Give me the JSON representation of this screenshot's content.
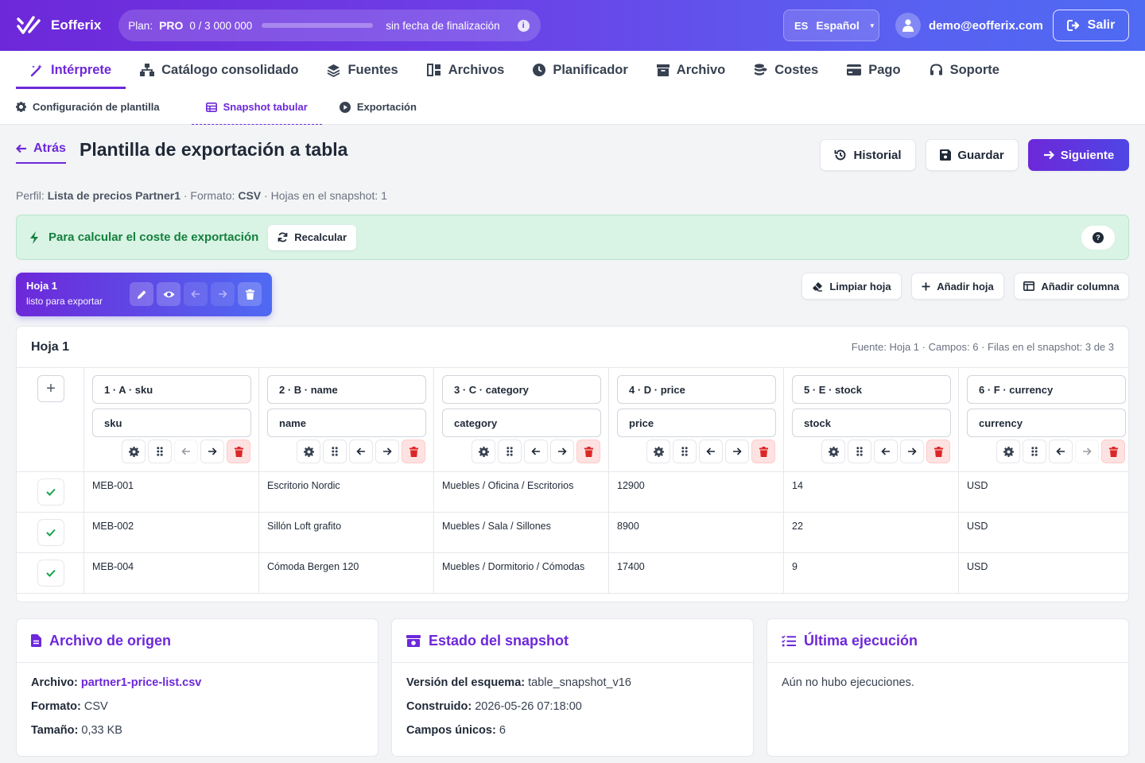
{
  "app": {
    "name": "Eofferix"
  },
  "plan": {
    "label": "Plan:",
    "tier": "PRO",
    "usage": "0 / 3 000 000",
    "usage_fraction": 0,
    "expiry": "sin fecha de finalización"
  },
  "language": {
    "code": "ES",
    "name": "Español"
  },
  "user": {
    "email": "demo@eofferix.com"
  },
  "logout": {
    "label": "Salir"
  },
  "nav": {
    "items": [
      {
        "label": "Intérprete",
        "icon": "wand-icon"
      },
      {
        "label": "Catálogo consolidado",
        "icon": "sitemap-icon"
      },
      {
        "label": "Fuentes",
        "icon": "layers-icon"
      },
      {
        "label": "Archivos",
        "icon": "tables-icon"
      },
      {
        "label": "Planificador",
        "icon": "clock-icon"
      },
      {
        "label": "Archivo",
        "icon": "archive-icon"
      },
      {
        "label": "Costes",
        "icon": "coins-icon"
      },
      {
        "label": "Pago",
        "icon": "card-icon"
      },
      {
        "label": "Soporte",
        "icon": "headset-icon"
      }
    ]
  },
  "subnav": {
    "items": [
      {
        "label": "Configuración de plantilla"
      },
      {
        "label": "Snapshot tabular"
      },
      {
        "label": "Exportación"
      }
    ]
  },
  "header": {
    "back": "Atrás",
    "title": "Plantilla de exportación a tabla",
    "history": "Historial",
    "save": "Guardar",
    "next": "Siguiente"
  },
  "profile": {
    "profile_label": "Perfil:",
    "profile": "Lista de precios Partner1",
    "format_label": "· Formato:",
    "format": "CSV",
    "sheets": "· Hojas en el snapshot: 1"
  },
  "alert": {
    "text": "Para calcular el coste de exportación",
    "recalc": "Recalcular",
    "help": "?"
  },
  "sheet": {
    "name": "Hoja 1",
    "status": "listo para exportar"
  },
  "sheet_actions": {
    "clear": "Limpiar hoja",
    "add_sheet": "Añadir hoja",
    "add_column": "Añadir columna"
  },
  "table": {
    "title": "Hoja 1",
    "meta": "Fuente: Hoja 1 · Campos: 6 · Filas en el snapshot: 3 de 3",
    "add": "+",
    "columns": [
      {
        "header": "1 · A · sku",
        "field": "sku"
      },
      {
        "header": "2 · B · name",
        "field": "name"
      },
      {
        "header": "3 · C · category",
        "field": "category"
      },
      {
        "header": "4 · D · price",
        "field": "price"
      },
      {
        "header": "5 · E · stock",
        "field": "stock"
      },
      {
        "header": "6 · F · currency",
        "field": "currency"
      }
    ],
    "rows": [
      [
        "MEB-001",
        "Escritorio Nordic",
        "Muebles / Oficina / Escritorios",
        "12900",
        "14",
        "USD"
      ],
      [
        "MEB-002",
        "Sillón Loft grafito",
        "Muebles / Sala / Sillones",
        "8900",
        "22",
        "USD"
      ],
      [
        "MEB-004",
        "Cómoda Bergen 120",
        "Muebles / Dormitorio / Cómodas",
        "17400",
        "9",
        "USD"
      ]
    ]
  },
  "source_file": {
    "title": "Archivo de origen",
    "file_label": "Archivo:",
    "file": "partner1-price-list.csv",
    "format_label": "Formato:",
    "format": "CSV",
    "size_label": "Tamaño:",
    "size": "0,33 KB"
  },
  "snapshot_state": {
    "title": "Estado del snapshot",
    "schema_label": "Versión del esquema:",
    "schema": "table_snapshot_v16",
    "built_label": "Construido:",
    "built": "2026-05-26 07:18:00",
    "fields_label": "Campos únicos:",
    "fields": "6"
  },
  "last_run": {
    "title": "Última ejecución",
    "text": "Aún no hubo ejecuciones."
  },
  "colors": {
    "accent": "#6d28d9",
    "accent2": "#4f6af3",
    "success_bg": "#d9f3e5",
    "success_text": "#15803d",
    "danger": "#dc2626"
  }
}
